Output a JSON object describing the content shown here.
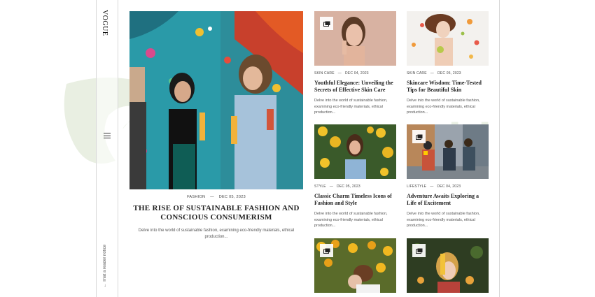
{
  "brand": {
    "logo": "VOGUE",
    "notice": "← That a reader notice"
  },
  "hero": {
    "category": "FASHION",
    "date": "DEC 05, 2023",
    "title": "THE RISE OF SUSTAINABLE FASHION AND CONSCIOUS CONSUMERISM",
    "excerpt": "Delve into the world of sustainable fashion, examining eco-friendly materials, ethical production..."
  },
  "cards": [
    {
      "category": "SKIN CARE",
      "date": "DEC 04, 2023",
      "title": "Youthful Elegance: Unveiling the Secrets of Effective Skin Care",
      "excerpt": "Delve into the world of sustainable fashion, examining eco-friendly materials, ethical production...",
      "icon": "gallery-icon"
    },
    {
      "category": "SKIN CARE",
      "date": "DEC 05, 2023",
      "title": "Skincare Wisdom: Time-Tested Tips for Beautiful Skin",
      "excerpt": "Delve into the world of sustainable fashion, examining eco-friendly materials, ethical production...",
      "icon": "none"
    },
    {
      "category": "STYLE",
      "date": "DEC 05, 2023",
      "title": "Classic Charm Timeless Icons of Fashion and Style",
      "excerpt": "Delve into the world of sustainable fashion, examining eco-friendly materials, ethical production...",
      "icon": "none"
    },
    {
      "category": "LIFESTYLE",
      "date": "DEC 04, 2023",
      "title": "Adventure Awaits Exploring a Life of Excitement",
      "excerpt": "Delve into the world of sustainable fashion, examining eco-friendly materials, ethical production...",
      "icon": "gallery-icon"
    },
    {
      "category": "",
      "date": "",
      "title": "",
      "excerpt": "",
      "icon": "gallery-icon"
    },
    {
      "category": "",
      "date": "",
      "title": "",
      "excerpt": "",
      "icon": "gallery-icon"
    }
  ],
  "colors": {
    "border": "#d8d8d8",
    "text": "#222222",
    "muted": "#555555",
    "watermark": "#e8eee0"
  }
}
